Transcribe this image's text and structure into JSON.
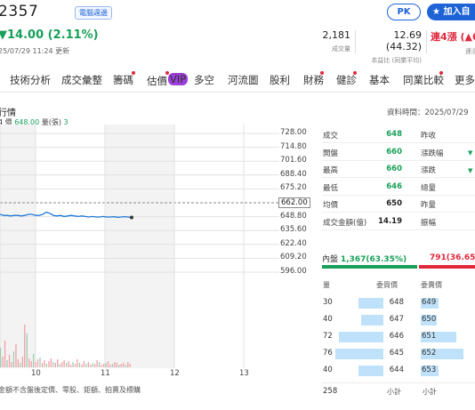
{
  "header": {
    "code": "2357",
    "tag": "電腦週邊",
    "pk_label": "PK",
    "add_label": "★ 加入自",
    "price_change": "▼14.00 (2.11%)",
    "timestamp": "25/07/29 11:24 更新"
  },
  "stats": [
    {
      "value": "2,181",
      "label": "成交量"
    },
    {
      "value": "12.69 (44.32)",
      "label": "本益比 (同業平均)"
    },
    {
      "value": "連4漲 (▲6",
      "label": "連漲連"
    }
  ],
  "nav": [
    "技術分析",
    "成交彙整",
    "籌碼",
    "估價",
    "多空",
    "河流圖",
    "股利",
    "財務",
    "健診",
    "基本",
    "同業比較",
    "更多"
  ],
  "nav_vip": "VIP",
  "chart": {
    "title": "行情",
    "sub_left": "4",
    "sub_price_label": "價",
    "sub_price": "648.00",
    "sub_vol_label": "量(張)",
    "sub_vol": "3",
    "updated": "資料時間：2025/07/29",
    "footnote": "金額不含盤後定價、零股、鉅額、拍賣及標購"
  },
  "chart_data": {
    "type": "line",
    "y_ticks": [
      "728.00",
      "714.80",
      "701.60",
      "688.40",
      "675.20",
      "662.00",
      "648.80",
      "635.60",
      "622.40",
      "609.20",
      "596.00"
    ],
    "reference_price": 662.0,
    "ylim": [
      596.0,
      728.0
    ],
    "x_ticks": [
      "10",
      "11",
      "12",
      "13"
    ],
    "price_series": [
      651,
      650,
      650,
      649.5,
      650,
      650,
      649.5,
      650,
      651,
      651,
      650,
      650,
      651,
      653,
      652,
      650,
      649.5,
      650,
      649,
      649.5,
      650,
      649.5,
      649,
      649.5,
      649,
      648.5,
      649,
      648.5,
      648.5,
      649,
      648.5,
      648.5,
      648.8,
      648.2,
      648.5,
      648.8,
      648.5,
      648
    ]
  },
  "quote": {
    "rows": [
      {
        "l1": "成交",
        "v1": "648",
        "c1": "green",
        "l2": "昨收"
      },
      {
        "l1": "開盤",
        "v1": "660",
        "c1": "green",
        "l2": "漲跌幅"
      },
      {
        "l1": "最高",
        "v1": "660",
        "c1": "green",
        "l2": "漲跌"
      },
      {
        "l1": "最低",
        "v1": "646",
        "c1": "green",
        "l2": "總量"
      },
      {
        "l1": "均價",
        "v1": "650",
        "c1": "dark",
        "l2": "昨量"
      },
      {
        "l1": "成交金額(億)",
        "v1": "14.19",
        "c1": "dark",
        "l2": "振幅"
      }
    ],
    "inner_label": "內盤",
    "inner_value": "1,367(63.35%)",
    "outer_value": "791(36.65%",
    "inner_ratio": 0.6335,
    "orderbook_headers": [
      "量",
      "委買價",
      "委賣價"
    ],
    "bids": [
      {
        "qty": "30",
        "price": "648"
      },
      {
        "qty": "40",
        "price": "647"
      },
      {
        "qty": "72",
        "price": "646"
      },
      {
        "qty": "76",
        "price": "645"
      },
      {
        "qty": "40",
        "price": "644"
      }
    ],
    "asks": [
      "649",
      "650",
      "651",
      "652",
      "653"
    ],
    "total_bid": "258",
    "subtotal_label": "小計"
  },
  "colors": {
    "up": "#e0283c",
    "down": "#18a05a",
    "accent": "#1e63d6",
    "line": "#1e78d6"
  }
}
